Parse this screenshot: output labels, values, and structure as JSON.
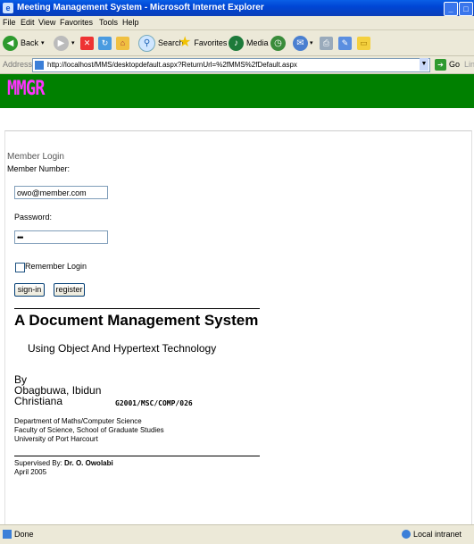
{
  "window": {
    "title": "Meeting Management System - Microsoft Internet Explorer"
  },
  "menu": [
    "File",
    "Edit",
    "View",
    "Favorites",
    "Tools",
    "Help"
  ],
  "toolbar": {
    "back_label": "Back",
    "search_label": "Search",
    "favorites_label": "Favorites",
    "media_label": "Media"
  },
  "address": {
    "label": "Address",
    "url": "http://localhost/MMS/desktopdefault.aspx?ReturnUrl=%2fMMS%2fDefault.aspx",
    "go_label": "Go",
    "links_label": "Links"
  },
  "banner": {
    "logo_text": "MMGR",
    "bg_color": "#008000",
    "logo_color": "#ff33ff"
  },
  "login": {
    "heading": "Member Login",
    "member_number_label": "Member Number:",
    "member_number_value": "owo@member.com",
    "password_label": "Password:",
    "password_value": "•••",
    "remember_label": "Remember Login",
    "signin_label": "sign-in",
    "register_label": "register"
  },
  "project": {
    "title": "A Document Management System",
    "subtitle": "Using Object And Hypertext Technology",
    "by": "By",
    "author_line1": "Obagbuwa, Ibidun",
    "author_line2": "Christiana",
    "reg_number": "G2001/MSC/COMP/026",
    "dept_line1": "Department of Maths/Computer Science",
    "dept_line2": "Faculty of Science, School of Graduate Studies",
    "dept_line3": "University of Port Harcourt",
    "supervised_label": "Supervised By:",
    "supervisor": "Dr. O. Owolabi",
    "date": "April 2005"
  },
  "status": {
    "text": "Done",
    "zone": "Local intranet"
  }
}
